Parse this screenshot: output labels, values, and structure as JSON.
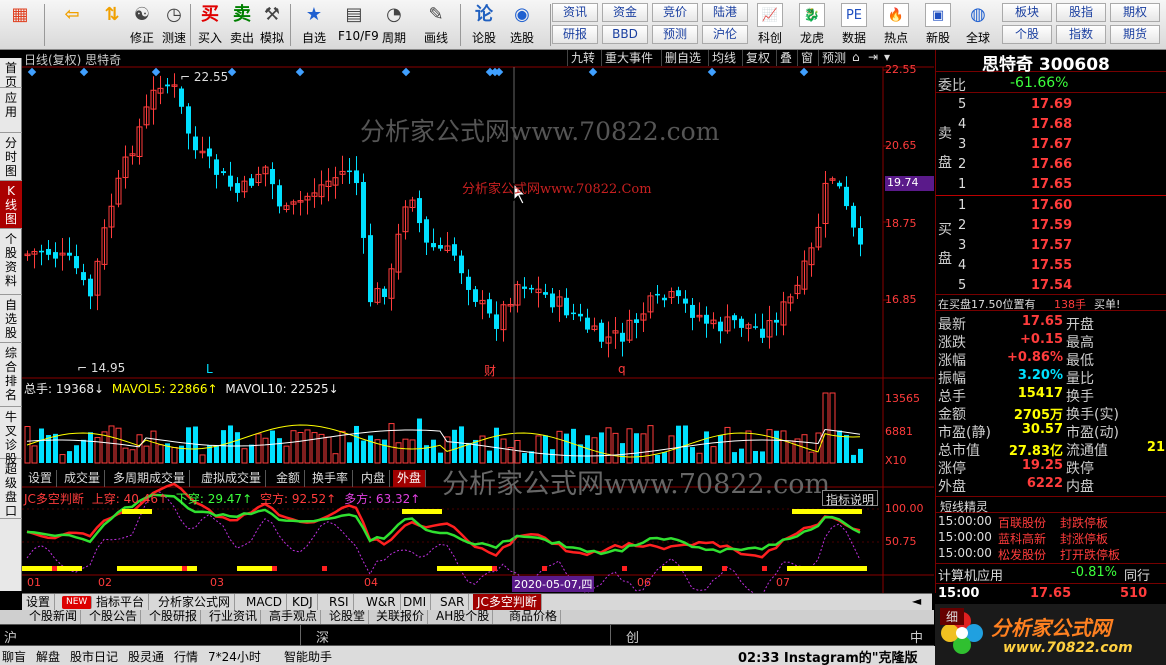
{
  "toolbar": {
    "buttons": [
      {
        "label": "",
        "icon": "windows-icon"
      },
      {
        "label": "",
        "icon": "back-arrow-icon"
      },
      {
        "label": "",
        "icon": "updown-arrows-icon"
      },
      {
        "label": "修正",
        "icon": "fix-icon"
      },
      {
        "label": "测速",
        "icon": "speed-icon"
      },
      {
        "label": "买入",
        "icon": "buy-icon",
        "icon_text": "买"
      },
      {
        "label": "卖出",
        "icon": "sell-icon",
        "icon_text": "卖"
      },
      {
        "label": "模拟",
        "icon": "hammer-icon"
      },
      {
        "label": "自选",
        "icon": "star-icon"
      },
      {
        "label": "F10/F9",
        "icon": "f10-icon"
      },
      {
        "label": "周期",
        "icon": "clock-cycle-icon"
      },
      {
        "label": "画线",
        "icon": "pencil-icon"
      },
      {
        "label": "论股",
        "icon": "discuss-icon",
        "icon_text": "论"
      },
      {
        "label": "选股",
        "icon": "select-icon"
      }
    ],
    "grid_left": [
      [
        "资讯",
        "资金",
        "竞价",
        "陆港"
      ],
      [
        "研报",
        "BBD",
        "预测",
        "沪伦"
      ]
    ],
    "mid_buttons": [
      "科创",
      "龙虎",
      "数据",
      "热点",
      "新股"
    ],
    "grid_right": [
      [
        "板块",
        "股指",
        "期权"
      ],
      [
        "个股",
        "指数",
        "期货"
      ]
    ],
    "globe_label": "全球"
  },
  "leftbar": {
    "tabs": [
      "首页",
      "应用",
      "分时图",
      "K线图",
      "个股资料",
      "自选股",
      "综合排名",
      "牛叉诊股",
      "超级盘口"
    ],
    "active_index": 3
  },
  "chart": {
    "header_left": "日线(复权)  思特奇",
    "header_tools": [
      "九转",
      "重大事件",
      "删自选",
      "均线",
      "复权",
      "叠",
      "窗",
      "预测"
    ],
    "price_ticks": [
      "22.55",
      "20.65",
      "18.75",
      "16.85"
    ],
    "current_price_tag": "19.74",
    "high_label": "22.55",
    "low_label": "14.95",
    "markers": [
      "L",
      "财",
      "q"
    ],
    "watermark_big": "分析家公式网www.70822.com",
    "watermark_small": "分析家公式网www.70822.Com",
    "volume_header": {
      "total": "总手: 19368↓",
      "ma5": "MAVOL5: 22866↑",
      "ma10": "MAVOL10: 22525↓"
    },
    "volume_ticks": [
      "13565",
      "6881",
      "X10"
    ],
    "vol_tabs": [
      "设置",
      "成交量",
      "多周期成交量",
      "虚拟成交量",
      "金额",
      "换手率",
      "内盘",
      "外盘"
    ],
    "indicator_header": {
      "name": "JC多空判断",
      "up": "上穿: 40.46↑",
      "down": "下穿: 29.47↑",
      "empty": "空方: 92.52↑",
      "many": "多方: 63.32↑"
    },
    "indicator_button": "指标说明",
    "indicator_ticks": [
      "100.00",
      "50.75"
    ],
    "date_axis": [
      "01",
      "02",
      "03",
      "04",
      "06",
      "07"
    ],
    "cursor_date": "2020-05-07,四"
  },
  "bottom_tabs": [
    "设置",
    "NEW",
    "指标平台",
    "分析家公式网",
    "MACD",
    "KDJ",
    "RSI",
    "W&R",
    "DMI",
    "SAR",
    "JC多空判断"
  ],
  "bottom_tabs2": [
    "个股新闻",
    "个股公告",
    "个股研报",
    "行业资讯",
    "高手观点",
    "论股堂",
    "关联报价",
    "AH股个股",
    "商品价格"
  ],
  "market_bar": [
    "沪",
    "深",
    "创",
    "中小"
  ],
  "status_bar": [
    "聊盲",
    "解盘",
    "股市日记",
    "股灵通",
    "行情",
    "7*24小时",
    "智能助手"
  ],
  "ticker_news": "02:33 Instagram的\"克隆版",
  "right": {
    "title": "思特奇 300608",
    "weibi_label": "委比",
    "weibi_value": "-61.66%",
    "sell_label": "卖盘",
    "buy_label": "买盘",
    "sells": [
      {
        "n": "5",
        "p": "17.69"
      },
      {
        "n": "4",
        "p": "17.68"
      },
      {
        "n": "3",
        "p": "17.67"
      },
      {
        "n": "2",
        "p": "17.66"
      },
      {
        "n": "1",
        "p": "17.65"
      }
    ],
    "buys": [
      {
        "n": "1",
        "p": "17.60"
      },
      {
        "n": "2",
        "p": "17.59"
      },
      {
        "n": "3",
        "p": "17.57"
      },
      {
        "n": "4",
        "p": "17.55"
      },
      {
        "n": "5",
        "p": "17.54"
      }
    ],
    "notice_left": "在买盘17.50位置有",
    "notice_vol": "138手",
    "notice_right": "买单!",
    "stats": [
      {
        "l1": "最新",
        "v1": "17.65",
        "l2": "开盘"
      },
      {
        "l1": "涨跌",
        "v1": "+0.15",
        "l2": "最高"
      },
      {
        "l1": "涨幅",
        "v1": "+0.86%",
        "l2": "最低"
      },
      {
        "l1": "振幅",
        "v1": "3.20%",
        "l2": "量比"
      },
      {
        "l1": "总手",
        "v1": "15417",
        "l2": "换手"
      },
      {
        "l1": "金额",
        "v1": "2705万",
        "l2": "换手(实)"
      },
      {
        "l1": "市盈(静)",
        "v1": "30.57",
        "l2": "市盈(动)"
      },
      {
        "l1": "总市值",
        "v1": "27.83亿",
        "l2": "流通值",
        "v2": "21"
      },
      {
        "l1": "涨停",
        "v1": "19.25",
        "l2": "跌停"
      },
      {
        "l1": "外盘",
        "v1": "6222",
        "l2": "内盘"
      }
    ],
    "short_title": "短线精灵",
    "short_items": [
      {
        "time": "15:00:00",
        "name": "百联股份",
        "event": "封跌停板"
      },
      {
        "time": "15:00:00",
        "name": "蓝科高新",
        "event": "封涨停板"
      },
      {
        "time": "15:00:00",
        "name": "松发股份",
        "event": "打开跌停板"
      }
    ],
    "sector_name": "计算机应用",
    "sector_change": "-0.81%",
    "sector_btn": "同行",
    "last_time": "15:00",
    "last_price": "17.65",
    "last_vol": "510",
    "small_tab": "细",
    "colors": {
      "up": "#ff3c3c",
      "down": "#00e0ff",
      "grid": "#8a0000"
    }
  },
  "logo_text": "分析家公式网",
  "logo_url": "www.70822.com"
}
